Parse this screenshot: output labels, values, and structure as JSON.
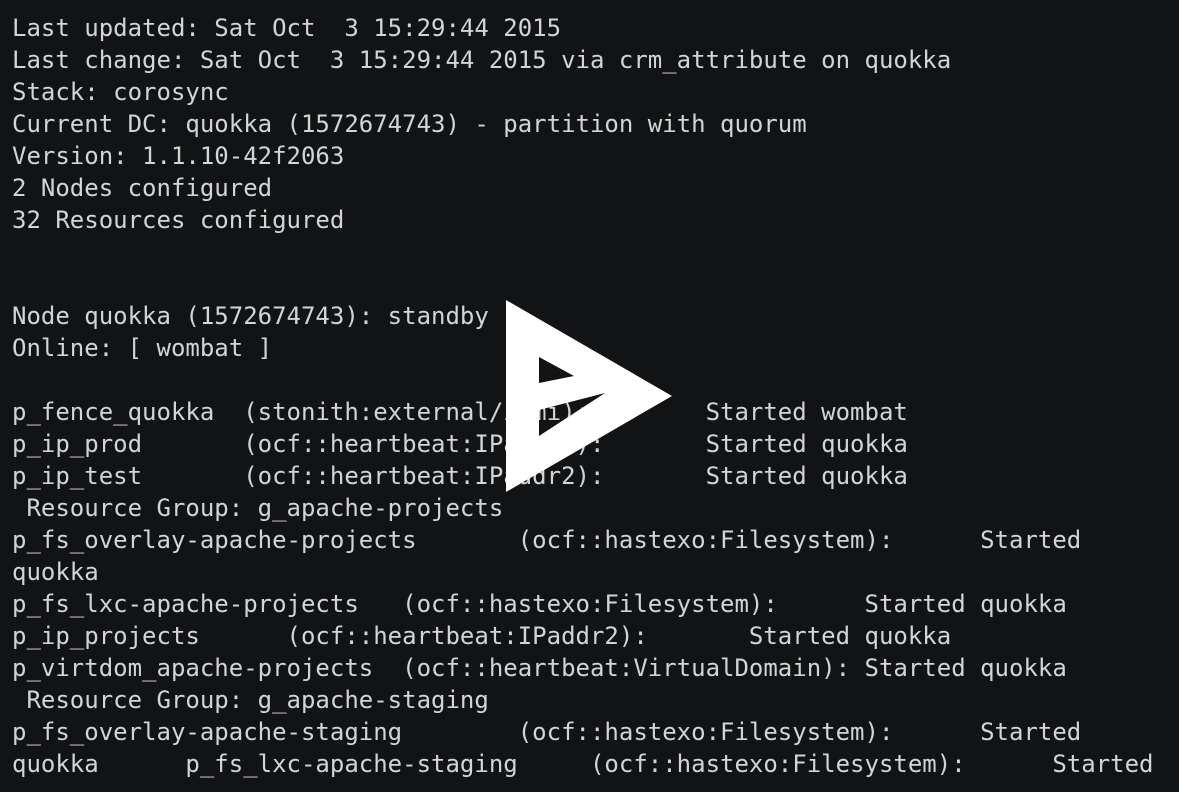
{
  "terminal": {
    "lines": [
      "Last updated: Sat Oct  3 15:29:44 2015",
      "Last change: Sat Oct  3 15:29:44 2015 via crm_attribute on quokka",
      "Stack: corosync",
      "Current DC: quokka (1572674743) - partition with quorum",
      "Version: 1.1.10-42f2063",
      "2 Nodes configured",
      "32 Resources configured",
      "",
      "",
      "Node quokka (1572674743): standby",
      "Online: [ wombat ]",
      "",
      "p_fence_quokka  (stonith:external/ipmi):        Started wombat",
      "p_ip_prod       (ocf::heartbeat:IPaddr2):       Started quokka",
      "p_ip_test       (ocf::heartbeat:IPaddr2):       Started quokka",
      " Resource Group: g_apache-projects",
      "p_fs_overlay-apache-projects       (ocf::hastexo:Filesystem):      Started",
      "quokka",
      "p_fs_lxc-apache-projects   (ocf::hastexo:Filesystem):      Started quokka",
      "p_ip_projects      (ocf::heartbeat:IPaddr2):       Started quokka",
      "p_virtdom_apache-projects  (ocf::heartbeat:VirtualDomain): Started quokka",
      " Resource Group: g_apache-staging",
      "p_fs_overlay-apache-staging        (ocf::hastexo:Filesystem):      Started",
      "quokka      p_fs_lxc-apache-staging     (ocf::hastexo:Filesystem):      Started"
    ]
  },
  "player": {
    "icon": "play-icon"
  },
  "colors": {
    "background": "#121314",
    "text": "#d2d4d6",
    "play_icon": "#ffffff"
  }
}
